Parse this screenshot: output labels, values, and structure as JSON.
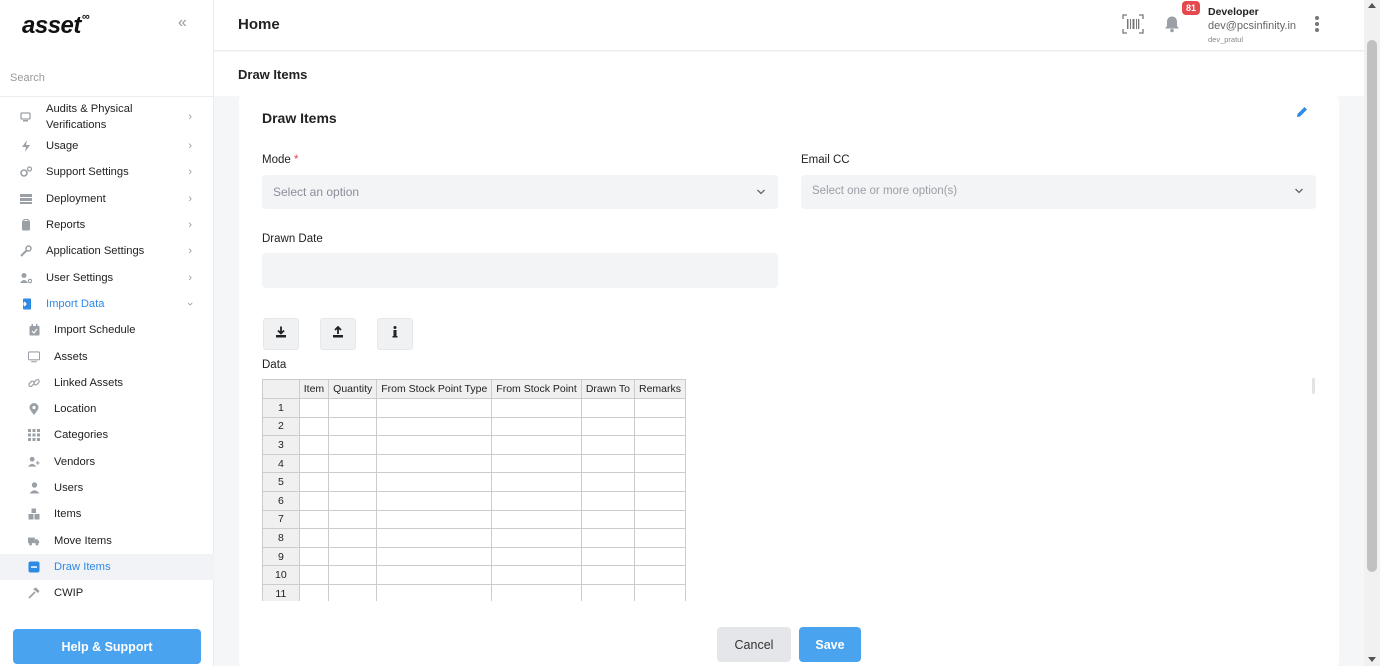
{
  "app": {
    "logo_text": "asset",
    "logo_sup": "∞"
  },
  "sidebar": {
    "search_placeholder": "Search",
    "items": [
      {
        "label": "Audits & Physical Verifications",
        "icon": "audit-icon"
      },
      {
        "label": "Usage",
        "icon": "bolt-icon"
      },
      {
        "label": "Support Settings",
        "icon": "cogs-icon"
      },
      {
        "label": "Deployment",
        "icon": "server-icon"
      },
      {
        "label": "Reports",
        "icon": "clipboard-icon"
      },
      {
        "label": "Application Settings",
        "icon": "wrench-icon"
      },
      {
        "label": "User Settings",
        "icon": "user-cog-icon"
      },
      {
        "label": "Import Data",
        "icon": "file-import-icon"
      }
    ],
    "sub_items": [
      {
        "label": "Import Schedule",
        "icon": "calendar-icon"
      },
      {
        "label": "Assets",
        "icon": "monitor-icon"
      },
      {
        "label": "Linked Assets",
        "icon": "link-icon"
      },
      {
        "label": "Location",
        "icon": "map-pin-icon"
      },
      {
        "label": "Categories",
        "icon": "grid-icon"
      },
      {
        "label": "Vendors",
        "icon": "user-plus-icon"
      },
      {
        "label": "Users",
        "icon": "user-icon"
      },
      {
        "label": "Items",
        "icon": "boxes-icon"
      },
      {
        "label": "Move Items",
        "icon": "truck-icon"
      },
      {
        "label": "Draw Items",
        "icon": "minus-square-icon"
      },
      {
        "label": "CWIP",
        "icon": "hammer-icon"
      }
    ],
    "help_label": "Help & Support"
  },
  "header": {
    "title": "Home",
    "notification_count": "81",
    "user_name": "Developer",
    "user_email": "dev@pcsinfinity.in",
    "user_handle": "dev_pratul"
  },
  "breadcrumb": "Draw Items",
  "form": {
    "title": "Draw Items",
    "mode_label": "Mode",
    "mode_required": "*",
    "mode_placeholder": "Select an option",
    "email_cc_label": "Email CC",
    "email_cc_placeholder": "Select one or more option(s)",
    "drawn_date_label": "Drawn Date",
    "drawn_date_value": "",
    "data_label": "Data",
    "columns": [
      "Item",
      "Quantity",
      "From Stock Point Type",
      "From Stock Point",
      "Drawn To",
      "Remarks"
    ],
    "rows": [
      "1",
      "2",
      "3",
      "4",
      "5",
      "6",
      "7",
      "8",
      "9",
      "10",
      "11"
    ],
    "cancel_label": "Cancel",
    "save_label": "Save"
  },
  "colors": {
    "accent": "#4aa3ee",
    "active_text": "#2d8ae5",
    "badge": "#e5484d"
  }
}
